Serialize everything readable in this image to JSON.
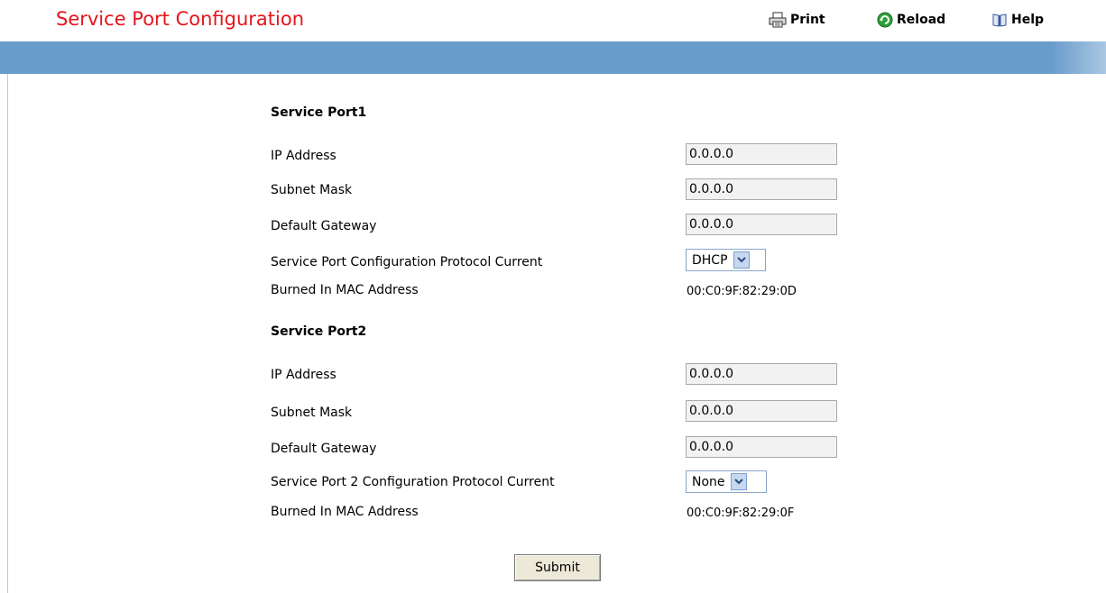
{
  "page_title": "Service Port Configuration",
  "toolbar": {
    "print_label": "Print",
    "reload_label": "Reload",
    "help_label": "Help"
  },
  "service_port1": {
    "title": "Service Port1",
    "ip_label": "IP Address",
    "ip_value": "0.0.0.0",
    "subnet_label": "Subnet Mask",
    "subnet_value": "0.0.0.0",
    "gateway_label": "Default Gateway",
    "gateway_value": "0.0.0.0",
    "protocol_label": "Service Port Configuration Protocol Current",
    "protocol_value": "DHCP",
    "mac_label": "Burned In MAC Address",
    "mac_value": "00:C0:9F:82:29:0D"
  },
  "service_port2": {
    "title": "Service Port2",
    "ip_label": "IP Address",
    "ip_value": "0.0.0.0",
    "subnet_label": "Subnet Mask",
    "subnet_value": "0.0.0.0",
    "gateway_label": "Default Gateway",
    "gateway_value": "0.0.0.0",
    "protocol_label": "Service Port 2 Configuration Protocol Current",
    "protocol_value": "None",
    "mac_label": "Burned In MAC Address",
    "mac_value": "00:C0:9F:82:29:0F"
  },
  "submit_label": "Submit",
  "colors": {
    "title": "#e5141b",
    "bar": "#6a9ccb"
  }
}
